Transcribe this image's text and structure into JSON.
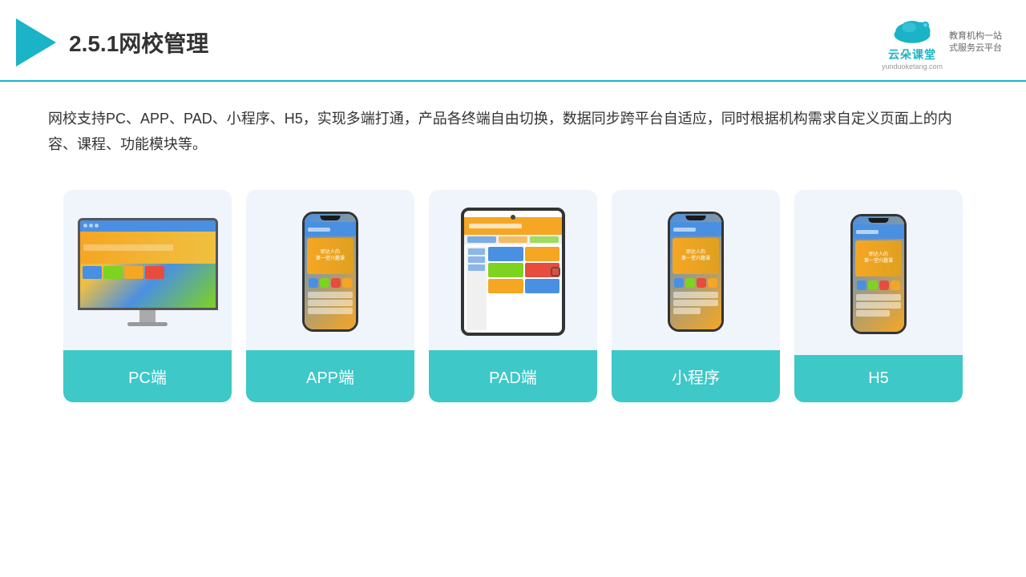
{
  "header": {
    "title": "2.5.1网校管理",
    "logo": {
      "name": "云朵课堂",
      "url": "yunduoketang.com",
      "tagline_line1": "教育机构一站",
      "tagline_line2": "式服务云平台"
    }
  },
  "description": {
    "text": "网校支持PC、APP、PAD、小程序、H5，实现多端打通，产品各终端自由切换，数据同步跨平台自适应，同时根据机构需求自定义页面上的内容、课程、功能模块等。"
  },
  "cards": [
    {
      "id": "pc",
      "label": "PC端"
    },
    {
      "id": "app",
      "label": "APP端"
    },
    {
      "id": "pad",
      "label": "PAD端"
    },
    {
      "id": "miniprogram",
      "label": "小程序"
    },
    {
      "id": "h5",
      "label": "H5"
    }
  ],
  "colors": {
    "accent": "#1ab3c8",
    "teal": "#3ec8c8",
    "cardBg": "#f0f4fb",
    "border": "#1ab3c8"
  }
}
